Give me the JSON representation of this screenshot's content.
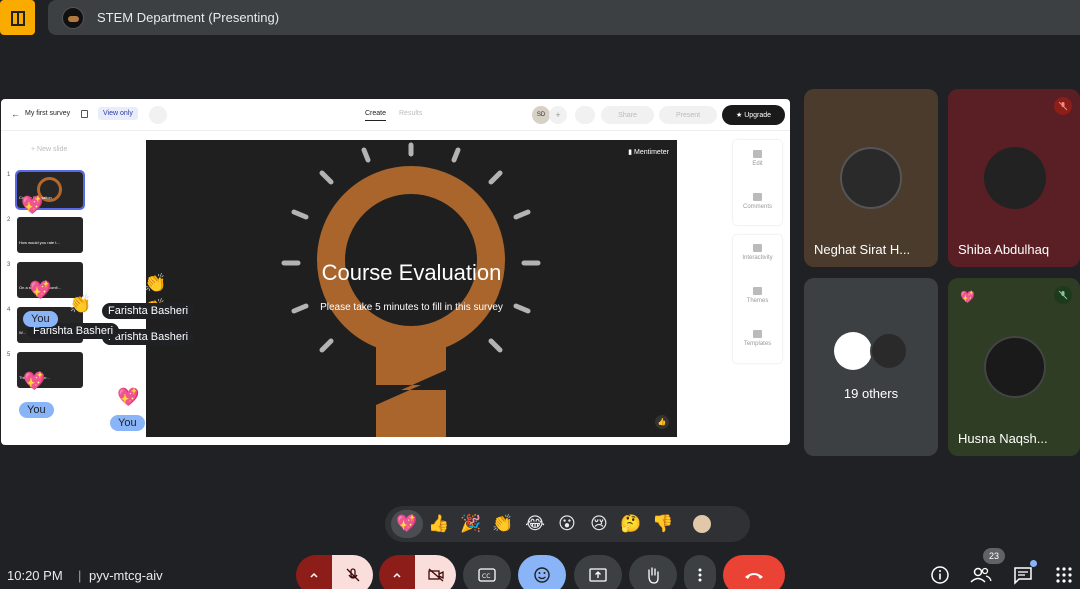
{
  "meeting": {
    "title": "STEM Department (Presenting)",
    "time": "10:20 PM",
    "separator": "|",
    "code": "pyv-mtcg-aiv",
    "participant_count": "23"
  },
  "presentation": {
    "survey_name": "My first survey",
    "view_only": "View only",
    "tabs": [
      "Create",
      "Results"
    ],
    "avatar_initials": "SD",
    "share_label": "Share",
    "present_label": "Present",
    "upgrade_label": "Upgrade",
    "new_slide_label": "+ New slide",
    "slides": [
      {
        "num": "1",
        "text": "Course Evaluation"
      },
      {
        "num": "2",
        "text": "How would you rate t..."
      },
      {
        "num": "3",
        "text": "On a sc...h, how confi..."
      },
      {
        "num": "4",
        "text": "W..."
      },
      {
        "num": "5",
        "text": "Thi...ng us impr..."
      }
    ],
    "brand": "Mentimeter",
    "slide_title": "Course Evaluation",
    "slide_subtitle": "Please take 5 minutes to fill in this survey",
    "side_tools": [
      "Edit",
      "Comments",
      "Interactivity",
      "Themes",
      "Templates"
    ]
  },
  "reactions_overlay": {
    "names": [
      "Farishta Basheri",
      "Farishta Basheri",
      "Farishta Basheri"
    ],
    "you_labels": [
      "You",
      "You",
      "You"
    ]
  },
  "participants": [
    {
      "name": "Neghat Sirat H...",
      "muted": false
    },
    {
      "name": "Shiba Abdulhaq",
      "muted": true
    },
    {
      "name": "19 others",
      "muted": false
    },
    {
      "name": "Husna Naqsh...",
      "muted": true
    }
  ],
  "reaction_bar": {
    "emojis": [
      "💖",
      "👍",
      "🎉",
      "👏",
      "😂",
      "😮",
      "😢",
      "🤔",
      "👎"
    ]
  },
  "colors": {
    "background": "#202124",
    "accent_blue": "#8ab4f8",
    "end_call": "#ea4335",
    "mic_off": "#8c1d18",
    "logo_yellow": "#f9ab00"
  }
}
